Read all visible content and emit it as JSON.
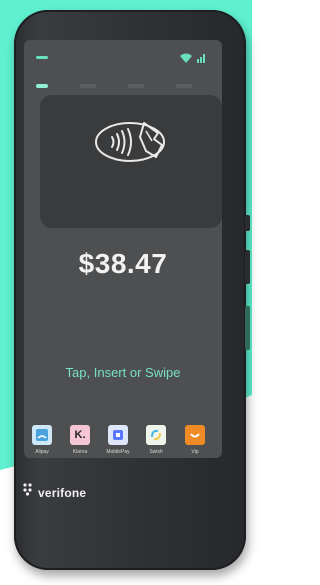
{
  "colors": {
    "accent": "#69e0bd",
    "prompt": "#78e2c3",
    "screen_bg": "#4d4f50",
    "card_bg": "#3a3b3c",
    "backdrop_teal": "#5ff0d0"
  },
  "payment": {
    "amount": "$38.47",
    "prompt": "Tap, Insert or Swipe"
  },
  "apps": [
    {
      "label": "Alipay",
      "icon": "alipay-icon"
    },
    {
      "label": "Klarna",
      "icon": "klarna-icon",
      "glyph": "K."
    },
    {
      "label": "MobilePay",
      "icon": "mobilepay-icon"
    },
    {
      "label": "Swish",
      "icon": "swish-icon"
    },
    {
      "label": "Vip",
      "icon": "vipps-icon"
    }
  ],
  "brand": {
    "name": "verifone"
  },
  "icons": {
    "contactless": "contactless-tap-icon",
    "wifi": "wifi-icon",
    "signal": "signal-icon"
  }
}
